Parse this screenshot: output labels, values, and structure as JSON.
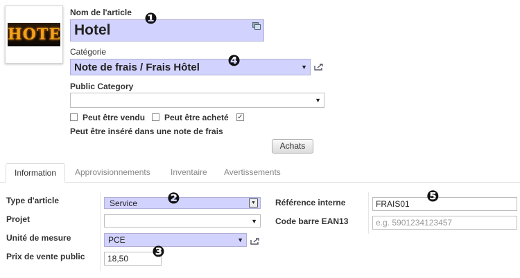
{
  "product": {
    "name_label": "Nom de l'article",
    "name_value": "Hotel",
    "image_text": "HOTEL",
    "category_label": "Catégorie",
    "category_value": "Note de frais / Frais Hôtel",
    "public_category_label": "Public Category",
    "public_category_value": "",
    "checkboxes": [
      {
        "label": "Peut être vendu",
        "checked": false
      },
      {
        "label": "Peut être acheté",
        "checked": false
      },
      {
        "label": "",
        "checked": true
      }
    ],
    "expense_note": "Peut être inséré dans une note de frais",
    "achats_button": "Achats"
  },
  "tabs": [
    {
      "label": "Information",
      "active": true
    },
    {
      "label": "Approvisionnements",
      "active": false
    },
    {
      "label": "Inventaire",
      "active": false
    },
    {
      "label": "Avertissements",
      "active": false
    }
  ],
  "info": {
    "type_label": "Type d'article",
    "type_value": "Service",
    "projet_label": "Projet",
    "projet_value": "",
    "uom_label": "Unité de mesure",
    "uom_value": "PCE",
    "price_label": "Prix de vente public",
    "price_value": "18,50",
    "ref_label": "Référence interne",
    "ref_value": "FRAIS01",
    "ean_label": "Code barre EAN13",
    "ean_placeholder": "e.g. 5901234123457"
  },
  "callouts": [
    "❶",
    "❷",
    "❸",
    "❹",
    "❺"
  ],
  "colors": {
    "required_bg": "#d2d2ff",
    "active_tab_text": "#333333",
    "inactive_tab_text": "#888888"
  }
}
